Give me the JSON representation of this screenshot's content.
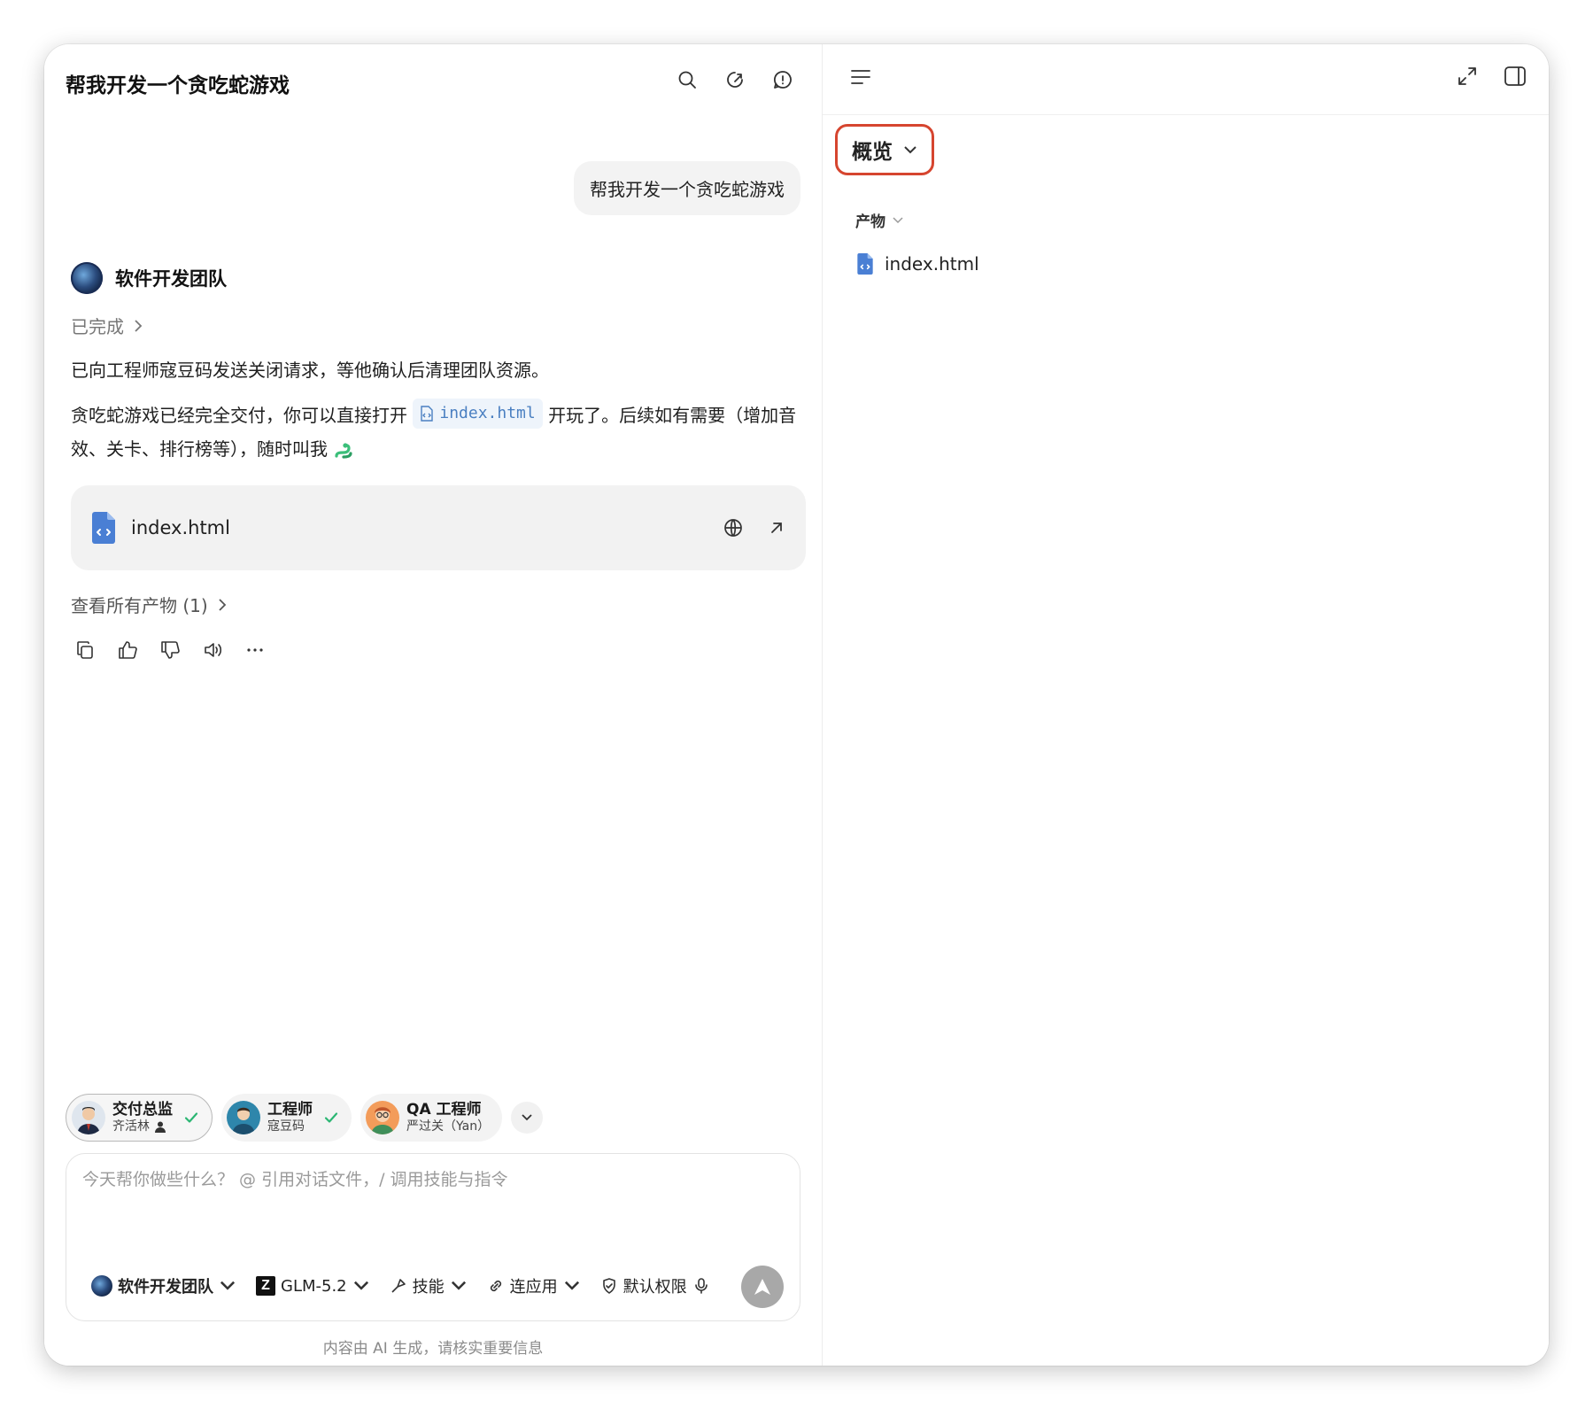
{
  "left": {
    "title": "帮我开发一个贪吃蛇游戏",
    "user_message": "帮我开发一个贪吃蛇游戏",
    "agent_name": "软件开发团队",
    "status": "已完成",
    "para1": "已向工程师寇豆码发送关闭请求，等他确认后清理团队资源。",
    "para2_before": "贪吃蛇游戏已经完全交付，你可以直接打开 ",
    "para2_inline_file": "index.html",
    "para2_after": " 开玩了。后续如有需要（增加音效、关卡、排行榜等），随时叫我",
    "file_card_name": "index.html",
    "view_all": "查看所有产物 (1)",
    "agents": [
      {
        "role": "交付总监",
        "name": "齐活林"
      },
      {
        "role": "工程师",
        "name": "寇豆码"
      },
      {
        "role": "QA 工程师",
        "name": "严过关（Yan）"
      }
    ],
    "input_placeholder": "今天帮你做些什么？ @ 引用对话文件，/ 调用技能与指令",
    "toolbar": {
      "team": "软件开发团队",
      "model": "GLM-5.2",
      "skills": "技能",
      "connect": "连应用",
      "permission": "默认权限"
    },
    "disclaimer": "内容由 AI 生成，请核实重要信息"
  },
  "right": {
    "overview_label": "概览",
    "section_label": "产物",
    "file_name": "index.html"
  },
  "colors": {
    "highlight_border": "#d6452f",
    "check_green": "#2bb673",
    "file_icon_blue": "#4a7fd4"
  }
}
